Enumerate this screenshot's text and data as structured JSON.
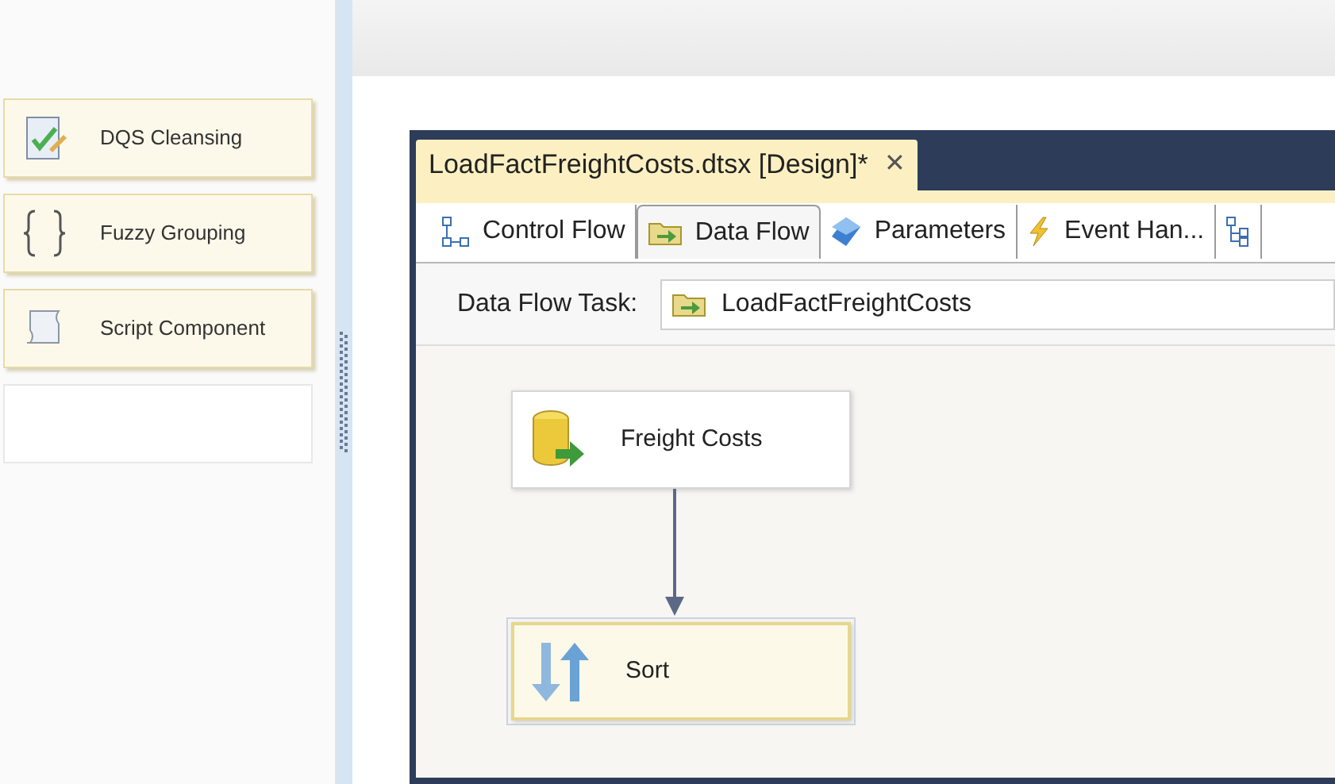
{
  "toolbox": {
    "items": [
      {
        "label": "DQS Cleansing",
        "kind": "document-check"
      },
      {
        "label": "Fuzzy Grouping",
        "kind": "braces"
      },
      {
        "label": "Script Component",
        "kind": "scroll"
      }
    ]
  },
  "document": {
    "title": "LoadFactFreightCosts.dtsx [Design]*",
    "close": "✕",
    "tabs": [
      {
        "label": "Control Flow",
        "kind": "control-flow",
        "selected": false
      },
      {
        "label": "Data Flow",
        "kind": "data-flow",
        "selected": true
      },
      {
        "label": "Parameters",
        "kind": "parameters",
        "selected": false
      },
      {
        "label": "Event Han...",
        "kind": "event",
        "selected": false
      },
      {
        "kind": "explorer",
        "selected": false
      }
    ],
    "task_label": "Data Flow Task:",
    "task_value": "LoadFactFreightCosts",
    "nodes": [
      {
        "label": "Freight Costs",
        "kind": "source",
        "selected": false
      },
      {
        "label": "Sort",
        "kind": "sort",
        "selected": true
      }
    ]
  }
}
